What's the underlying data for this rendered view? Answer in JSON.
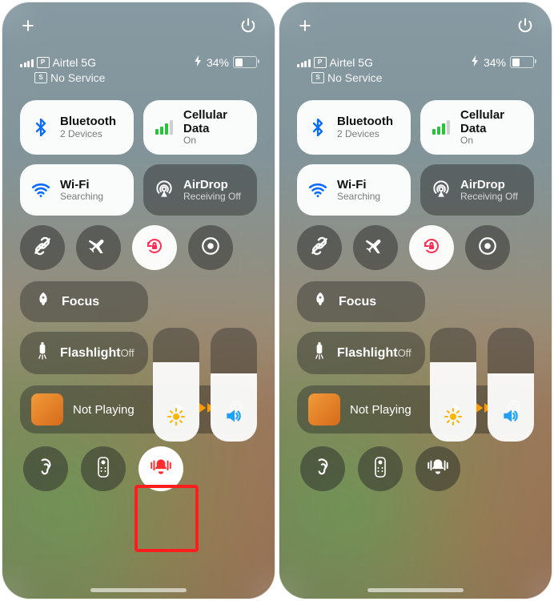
{
  "status": {
    "carriers": [
      {
        "sim": "P",
        "name": "Airtel 5G"
      },
      {
        "sim": "S",
        "name": "No Service"
      }
    ],
    "battery_pct": "34%",
    "battery_fill": 0.34
  },
  "tiles": {
    "bluetooth": {
      "title": "Bluetooth",
      "sub": "2 Devices"
    },
    "cellular": {
      "title": "Cellular Data",
      "sub": "On"
    },
    "wifi": {
      "title": "Wi-Fi",
      "sub": "Searching"
    },
    "airdrop": {
      "title": "AirDrop",
      "sub": "Receiving Off"
    }
  },
  "focus": {
    "title": "Focus"
  },
  "flashlight": {
    "title": "Flashlight",
    "sub": "Off"
  },
  "media": {
    "label": "Not Playing"
  },
  "sliders": {
    "brightness_fill": 0.7,
    "volume_fill": 0.6
  },
  "silent_left_on": true,
  "silent_right_on": false,
  "highlight_on_left": true
}
